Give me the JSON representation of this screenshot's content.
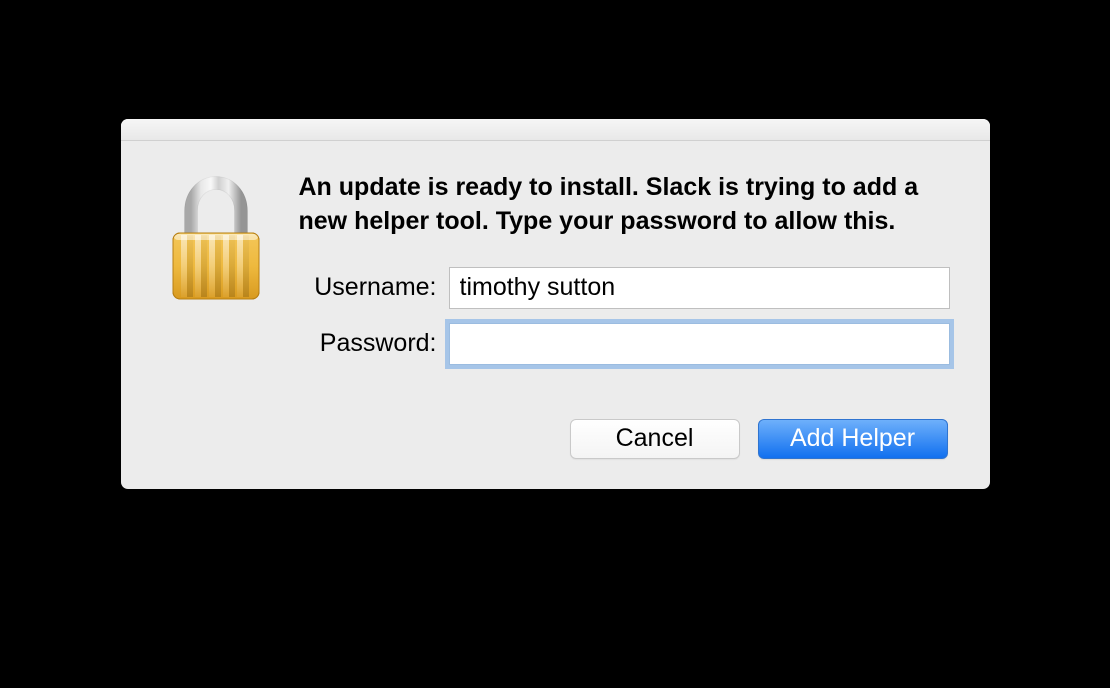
{
  "dialog": {
    "message": "An update is ready to install. Slack is trying to add a new helper tool. Type your password to allow this.",
    "username_label": "Username:",
    "password_label": "Password:",
    "username_value": "timothy sutton",
    "password_value": "",
    "cancel_label": "Cancel",
    "confirm_label": "Add Helper"
  },
  "icon": {
    "name": "lock-icon"
  }
}
